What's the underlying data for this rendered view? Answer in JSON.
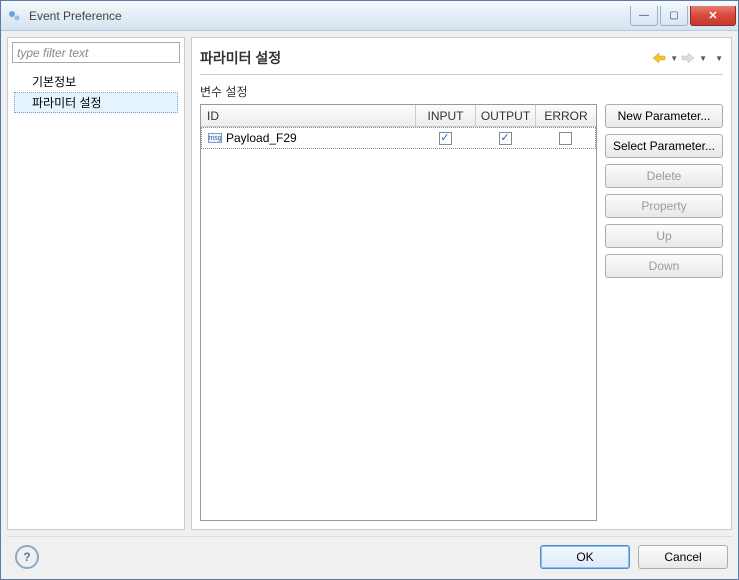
{
  "window": {
    "title": "Event Preference"
  },
  "filter": {
    "placeholder": "type filter text",
    "value": ""
  },
  "tree": {
    "items": [
      {
        "label": "기본정보",
        "selected": false
      },
      {
        "label": "파라미터 설정",
        "selected": true
      }
    ]
  },
  "page": {
    "title": "파라미터 설정",
    "section_label": "변수 설정"
  },
  "table": {
    "columns": {
      "id": "ID",
      "input": "INPUT",
      "output": "OUTPUT",
      "error": "ERROR"
    },
    "rows": [
      {
        "icon": "msg",
        "id": "Payload_F29",
        "input": true,
        "output": true,
        "error": false
      }
    ]
  },
  "buttons": {
    "new": "New Parameter...",
    "select": "Select Parameter...",
    "delete": "Delete",
    "property": "Property",
    "up": "Up",
    "down": "Down"
  },
  "footer": {
    "ok": "OK",
    "cancel": "Cancel"
  }
}
